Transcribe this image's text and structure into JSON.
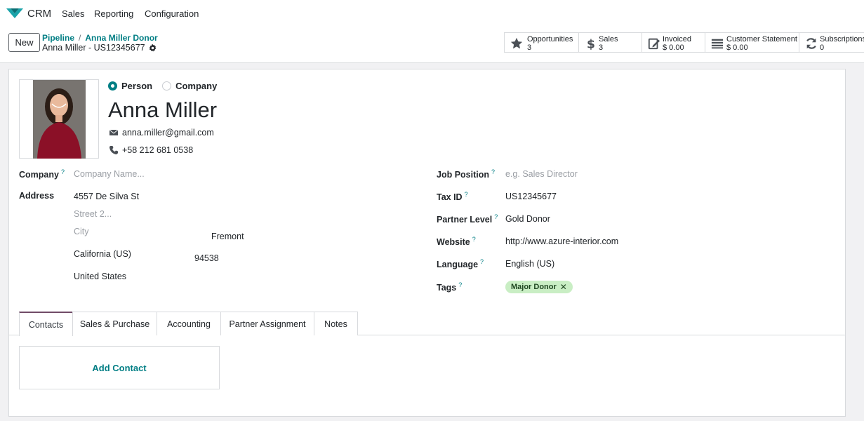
{
  "navbar": {
    "app_name": "CRM",
    "menus": [
      "Sales",
      "Reporting",
      "Configuration"
    ]
  },
  "control": {
    "new_label": "New",
    "breadcrumb": [
      "Pipeline",
      "Anna Miller Donor"
    ],
    "record_title": "Anna Miller - US12345677",
    "stats": [
      {
        "label": "Opportunities",
        "value": "3",
        "icon": "star-icon"
      },
      {
        "label": "Sales",
        "value": "3",
        "icon": "dollar-icon"
      },
      {
        "label": "Invoiced",
        "value": "$ 0.00",
        "icon": "invoice-icon"
      },
      {
        "label": "Customer Statement",
        "value": "$ 0.00",
        "icon": "list-icon"
      },
      {
        "label": "Subscriptions",
        "value": "0",
        "icon": "refresh-icon"
      }
    ]
  },
  "form": {
    "type_options": [
      "Person",
      "Company"
    ],
    "selected_type": "Person",
    "name": "Anna Miller",
    "email": "anna.miller@gmail.com",
    "phone": "+58 212 681 0538",
    "company": {
      "label": "Company",
      "help": "?",
      "placeholder": "Company Name..."
    },
    "address": {
      "label": "Address",
      "street": "4557 De Silva St",
      "street2_placeholder": "Street 2...",
      "city_placeholder": "City",
      "city_value": "Fremont",
      "state": "California (US)",
      "zip": "94538",
      "country": "United States"
    },
    "right_fields": [
      {
        "label": "Job Position",
        "help": "?",
        "placeholder": "e.g. Sales Director",
        "value": ""
      },
      {
        "label": "Tax ID",
        "help": "?",
        "value": "US12345677"
      },
      {
        "label": "Partner Level",
        "help": "?",
        "value": "Gold Donor"
      },
      {
        "label": "Website",
        "help": "?",
        "value": "http://www.azure-interior.com"
      },
      {
        "label": "Language",
        "help": "?",
        "value": "English (US)"
      },
      {
        "label": "Tags",
        "help": "?",
        "value": ""
      }
    ],
    "tags": [
      "Major Donor"
    ],
    "tag_remove": "✕"
  },
  "tabs": [
    "Contacts",
    "Sales & Purchase",
    "Accounting",
    "Partner Assignment",
    "Notes"
  ],
  "active_tab": "Contacts",
  "contacts": {
    "add_label": "Add Contact"
  },
  "colors": {
    "accent": "#017e84",
    "brand": "#714b67",
    "tag_bg": "#c9eec4"
  }
}
